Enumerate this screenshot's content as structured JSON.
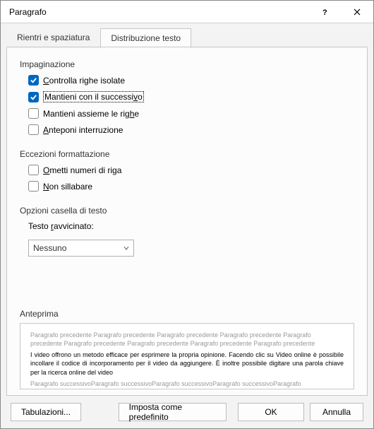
{
  "titlebar": {
    "title": "Paragrafo"
  },
  "tabs": {
    "indent": "Rientri e spaziatura",
    "flow": "Distribuzione testo"
  },
  "sections": {
    "pagination": "Impaginazione",
    "exceptions": "Eccezioni formattazione",
    "textbox": "Opzioni casella di testo",
    "preview": "Anteprima"
  },
  "options": {
    "widow_pre": "C",
    "widow_post": "ontrolla righe isolate",
    "keep_next_pre": "Mantieni con il successi",
    "keep_next_post": "v",
    "keep_next_post2": "o",
    "keep_lines_pre": "Mantieni assieme le rig",
    "keep_lines_post": "h",
    "keep_lines_post2": "e",
    "page_break_pre": "A",
    "page_break_post": "nteponi interruzione",
    "suppress_ln_pre": "O",
    "suppress_ln_post": "metti numeri di riga",
    "no_hyphen_pre": "N",
    "no_hyphen_post": "on sillabare"
  },
  "textbox": {
    "tight_pre": "Testo ",
    "tight_post": "r",
    "tight_post2": "avvicinato:",
    "tight_value": "Nessuno"
  },
  "preview": {
    "before": "Paragrafo precedente Paragrafo precedente Paragrafo precedente Paragrafo precedente Paragrafo precedente Paragrafo precedente Paragrafo precedente Paragrafo precedente Paragrafo precedente",
    "sample": "I video offrono un metodo efficace per esprimere la propria opinione. Facendo clic su Video online è possibile incollare il codice di incorporamento per il video da aggiungere. È inoltre possibile digitare una parola chiave per la ricerca online del video",
    "after": "Paragrafo successivoParagrafo successivoParagrafo successivoParagrafo successivoParagrafo successivoParagrafo"
  },
  "buttons": {
    "tabs": "Tabulazioni...",
    "default": "Imposta come predefinito",
    "ok": "OK",
    "cancel": "Annulla"
  }
}
